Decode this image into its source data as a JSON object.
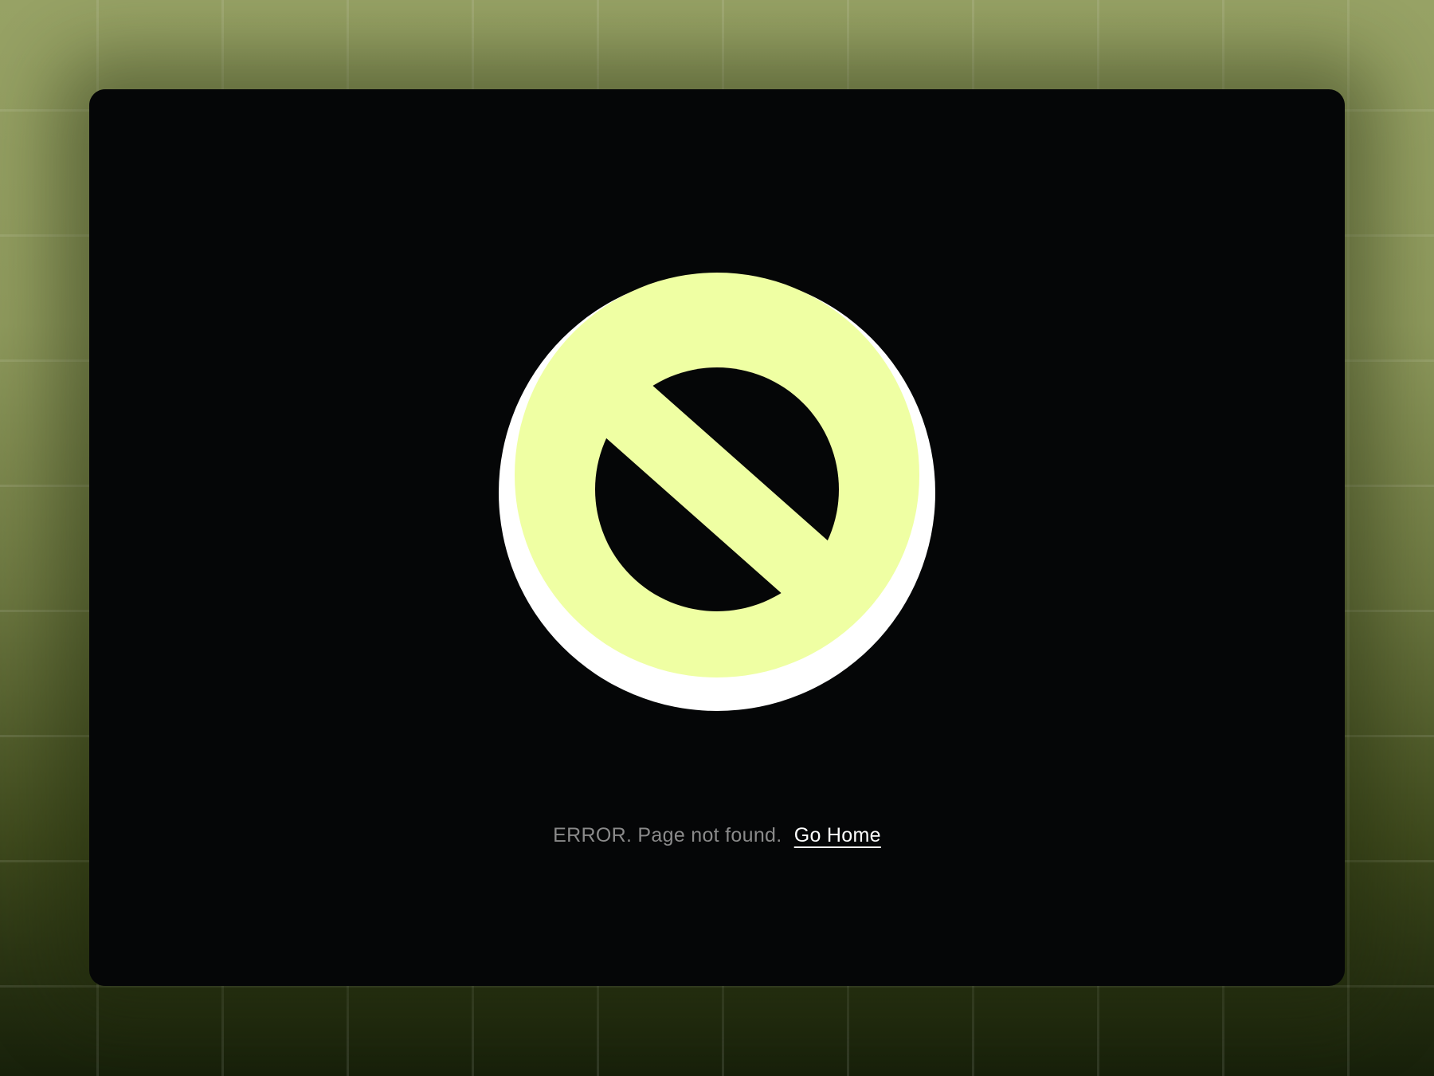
{
  "page": {
    "background_color": "#8f9a5d",
    "card_color": "#050607"
  },
  "icon": {
    "name": "prohibited-icon",
    "fill_color": "#efffa3",
    "shadow_color": "#ffffff"
  },
  "message": {
    "error_text": "ERROR. Page not found.",
    "link_label": "Go Home"
  }
}
